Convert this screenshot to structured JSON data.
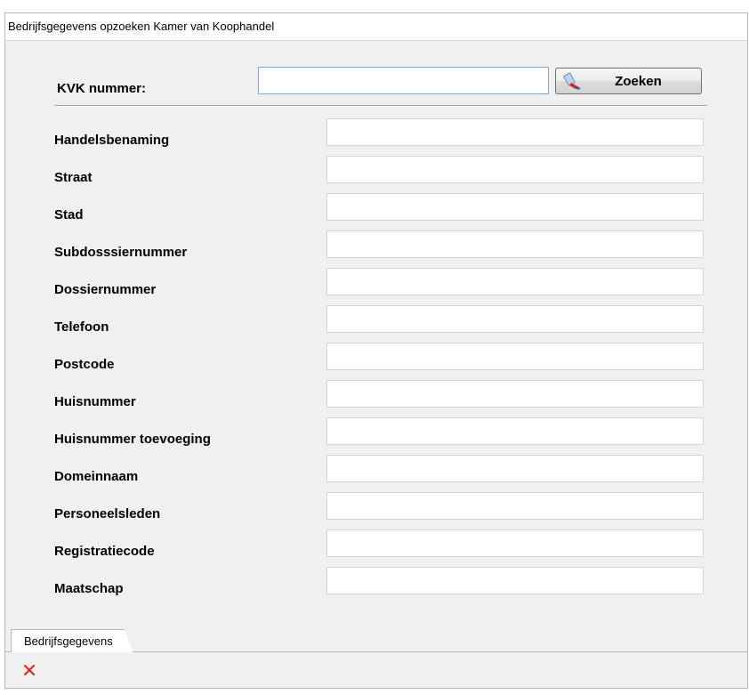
{
  "window": {
    "title": "Bedrijfsgegevens opzoeken Kamer van Koophandel"
  },
  "search": {
    "label": "KVK nummer:",
    "value": "",
    "button_label": "Zoeken"
  },
  "fields": [
    {
      "label": "Handelsbenaming",
      "value": ""
    },
    {
      "label": "Straat",
      "value": ""
    },
    {
      "label": "Stad",
      "value": ""
    },
    {
      "label": "Subdosssiernummer",
      "value": ""
    },
    {
      "label": "Dossiernummer",
      "value": ""
    },
    {
      "label": "Telefoon",
      "value": ""
    },
    {
      "label": "Postcode",
      "value": ""
    },
    {
      "label": "Huisnummer",
      "value": ""
    },
    {
      "label": "Huisnummer toevoeging",
      "value": ""
    },
    {
      "label": "Domeinnaam",
      "value": ""
    },
    {
      "label": "Personeelsleden",
      "value": ""
    },
    {
      "label": "Registratiecode",
      "value": ""
    },
    {
      "label": "Maatschap",
      "value": ""
    }
  ],
  "tabs": [
    {
      "label": "Bedrijfsgegevens",
      "active": true
    }
  ],
  "colors": {
    "close_icon": "#e02020",
    "window_bg": "#f0f0f0",
    "input_focus_border": "#7aa7d8"
  },
  "icons": {
    "search_button": "magnifier-icon",
    "bottom_bar": "close-icon"
  }
}
